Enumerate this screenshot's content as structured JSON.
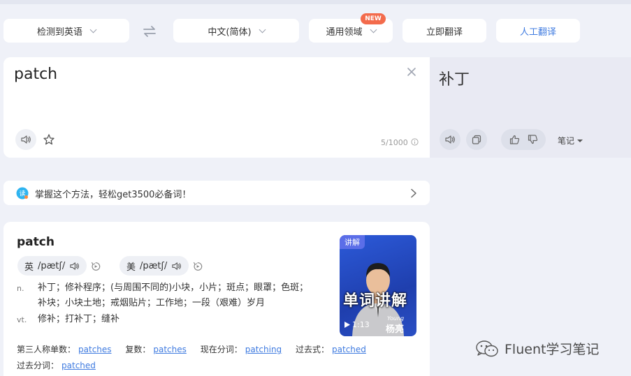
{
  "toolbar": {
    "source_lang": "检测到英语",
    "target_lang": "中文(简体)",
    "domain": "通用领域",
    "domain_badge": "NEW",
    "translate_now": "立即翻译",
    "human_translate": "人工翻译"
  },
  "source": {
    "text": "patch",
    "char_count": "5/1000"
  },
  "target": {
    "text": "补丁",
    "notes_label": "笔记"
  },
  "promo": {
    "text": "掌握这个方法，轻松get3500必备词！"
  },
  "dictionary": {
    "headword": "patch",
    "uk": {
      "label": "英",
      "ipa": "/pætʃ/"
    },
    "us": {
      "label": "美",
      "ipa": "/pætʃ/"
    },
    "senses": [
      {
        "pos": "n.",
        "def": "补丁；修补程序；(与周围不同的)小块，小片；斑点；眼罩；色斑；补块；小块土地；戒烟贴片；工作地；一段（艰难）岁月"
      },
      {
        "pos": "vt.",
        "def": "修补；打补丁；缝补"
      }
    ],
    "forms": [
      {
        "label": "第三人称单数：",
        "value": "patches"
      },
      {
        "label": "复数：",
        "value": "patches"
      },
      {
        "label": "现在分词：",
        "value": "patching"
      },
      {
        "label": "过去式：",
        "value": "patched"
      },
      {
        "label": "过去分词：",
        "value": "patched"
      }
    ]
  },
  "video": {
    "tag": "讲解",
    "caption": "单词讲解",
    "duration": "1:13",
    "presenter_en": "Young",
    "presenter": "杨亮"
  },
  "watermark": {
    "text": "Fluent学习笔记"
  },
  "colors": {
    "accent_blue": "#3f7be0",
    "badge_red": "#f36b4c",
    "page_bg": "#eff1f8",
    "target_bg": "#e9eaf3"
  }
}
